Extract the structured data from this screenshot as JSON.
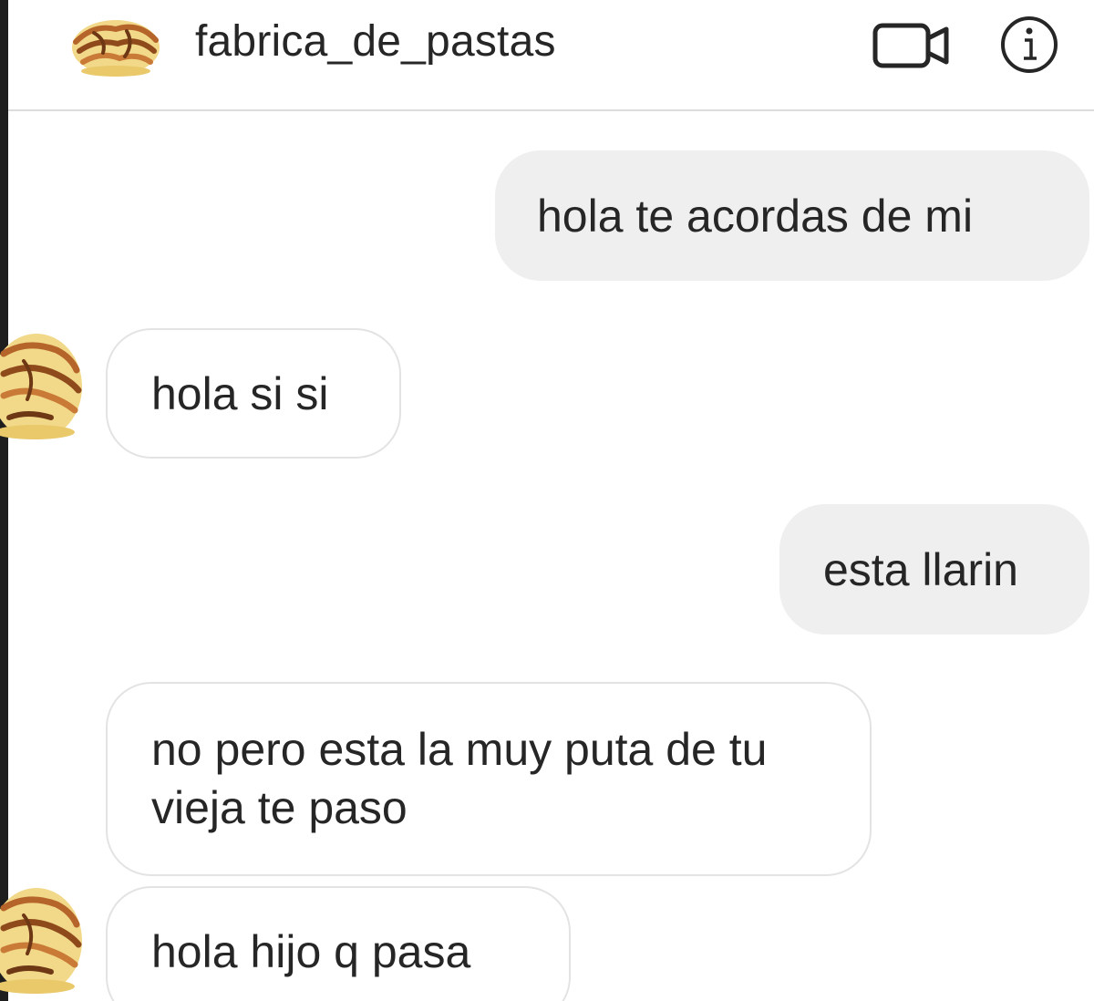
{
  "header": {
    "username": "fabrica_de_pastas",
    "avatar_icon": "pasta-avatar-icon",
    "video_call_icon": "video-camera-icon",
    "info_icon": "info-icon"
  },
  "messages": [
    {
      "sender": "me",
      "text": "hola te acordas de mi"
    },
    {
      "sender": "fabrica_de_pastas",
      "text": "hola si si"
    },
    {
      "sender": "me",
      "text": "esta llarin"
    },
    {
      "sender": "fabrica_de_pastas",
      "text": "no pero esta la muy puta de tu vieja te paso"
    },
    {
      "sender": "fabrica_de_pastas",
      "text": "hola hijo q pasa"
    }
  ],
  "colors": {
    "sent_bubble": "#efefef",
    "received_bubble_border": "#e3e3e3",
    "text": "#262626",
    "divider": "#dcdcdc"
  }
}
